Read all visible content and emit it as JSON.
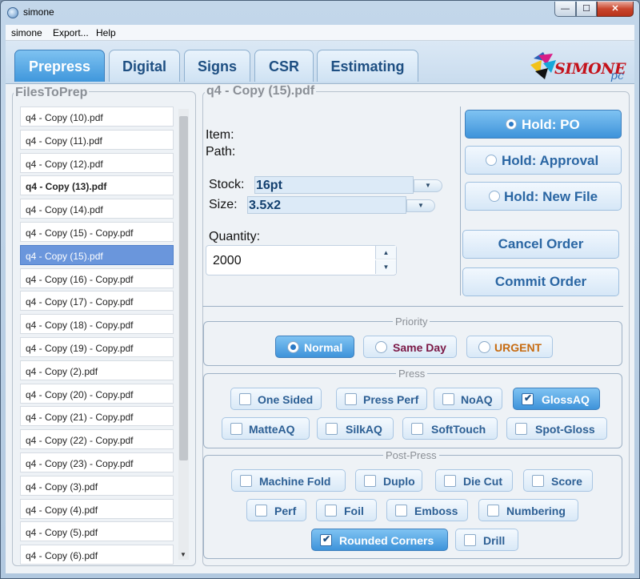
{
  "window": {
    "title": "simone",
    "minimize": "—",
    "maximize": "☐",
    "close": "✕"
  },
  "menu": [
    "simone",
    "Export...",
    "Help"
  ],
  "tabs": [
    "Prepress",
    "Digital",
    "Signs",
    "CSR",
    "Estimating"
  ],
  "logo": {
    "text": "SIMONE",
    "suffix": "pc"
  },
  "files": {
    "title": "FilesToPrep",
    "items": [
      "q4 - Copy (10).pdf",
      "q4 - Copy (11).pdf",
      "q4 - Copy (12).pdf",
      "q4 - Copy (13).pdf",
      "q4 - Copy (14).pdf",
      "q4 - Copy (15) - Copy.pdf",
      "q4 - Copy (15).pdf",
      "q4 - Copy (16) - Copy.pdf",
      "q4 - Copy (17) - Copy.pdf",
      "q4 - Copy (18) - Copy.pdf",
      "q4 - Copy (19) - Copy.pdf",
      "q4 - Copy (2).pdf",
      "q4 - Copy (20) - Copy.pdf",
      "q4 - Copy (21) - Copy.pdf",
      "q4 - Copy (22) - Copy.pdf",
      "q4 - Copy (23) - Copy.pdf",
      "q4 - Copy (3).pdf",
      "q4 - Copy (4).pdf",
      "q4 - Copy (5).pdf",
      "q4 - Copy (6).pdf"
    ],
    "bold_item": "q4 - Copy (13).pdf",
    "selected_item": "q4 - Copy (15).pdf"
  },
  "details": {
    "title": "q4 - Copy (15).pdf",
    "item_label": "Item:",
    "path_label": "Path:",
    "stock_label": "Stock:",
    "stock_value": "16pt",
    "size_label": "Size:",
    "size_value": "3.5x2",
    "quantity_label": "Quantity:",
    "quantity_value": "2000"
  },
  "hold": {
    "options": [
      "Hold: PO",
      "Hold: Approval",
      "Hold: New File"
    ],
    "selected": "Hold: PO"
  },
  "actions": {
    "cancel": "Cancel Order",
    "commit": "Commit Order"
  },
  "priority": {
    "title": "Priority",
    "options": [
      "Normal",
      "Same Day",
      "URGENT"
    ],
    "selected": "Normal"
  },
  "press": {
    "title": "Press",
    "options": [
      "One Sided",
      "Press Perf",
      "NoAQ",
      "GlossAQ",
      "MatteAQ",
      "SilkAQ",
      "SoftTouch",
      "Spot-Gloss"
    ],
    "checked": [
      "GlossAQ"
    ]
  },
  "postpress": {
    "title": "Post-Press",
    "options": [
      "Machine Fold",
      "Duplo",
      "Die Cut",
      "Score",
      "Perf",
      "Foil",
      "Emboss",
      "Numbering",
      "Rounded Corners",
      "Drill"
    ],
    "checked": [
      "Rounded Corners"
    ]
  },
  "colors": {
    "accent": "#3e93da",
    "logo_red": "#c4121b",
    "urgent": "#c76b10",
    "same_day": "#7b1745"
  }
}
